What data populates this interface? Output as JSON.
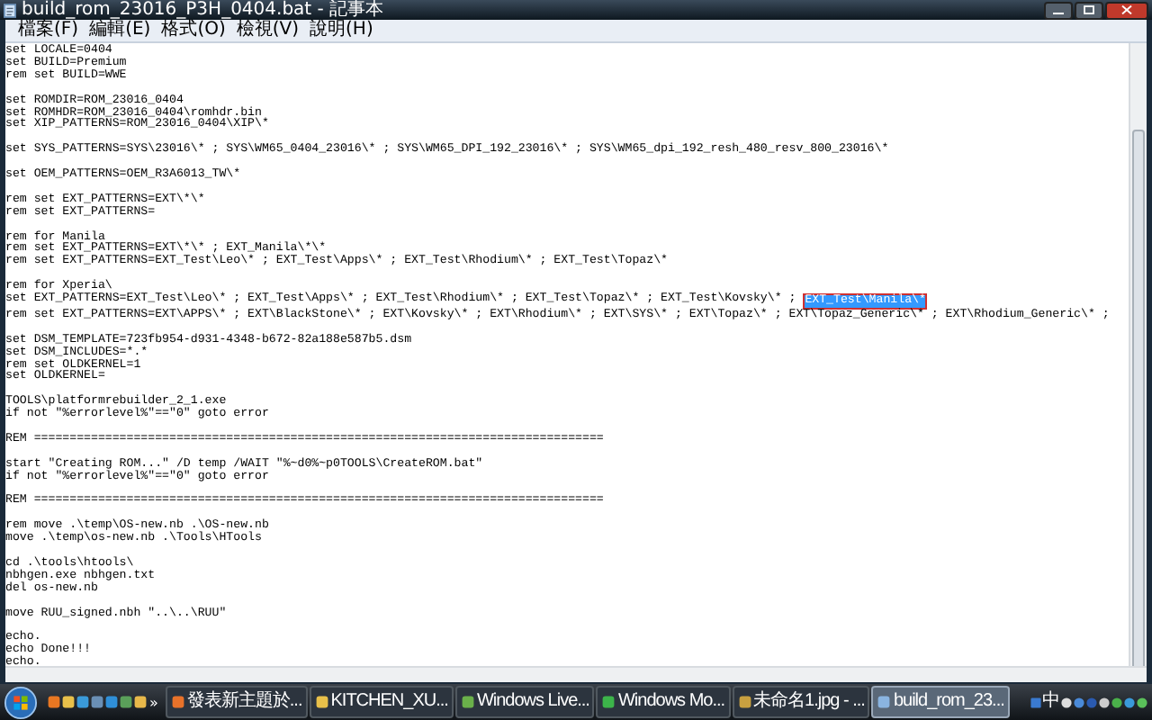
{
  "window": {
    "title": "build_rom_23016_P3H_0404.bat - 記事本"
  },
  "menu": [
    "檔案(F)",
    "編輯(E)",
    "格式(O)",
    "檢視(V)",
    "說明(H)"
  ],
  "editor": {
    "lines": [
      {
        "kind": "code",
        "text": "set LOCALE=0404"
      },
      {
        "kind": "code",
        "text": "set BUILD=Premium"
      },
      {
        "kind": "code",
        "text": "rem set BUILD=WWE"
      },
      {
        "kind": "blank"
      },
      {
        "kind": "code",
        "text": "set ROMDIR=ROM_23016_0404"
      },
      {
        "kind": "code",
        "text": "set ROMHDR=ROM_23016_0404\\romhdr.bin"
      },
      {
        "kind": "code",
        "text": "set XIP_PATTERNS=ROM_23016_0404\\XIP\\*"
      },
      {
        "kind": "blank"
      },
      {
        "kind": "code",
        "text": "set SYS_PATTERNS=SYS\\23016\\* ; SYS\\WM65_0404_23016\\* ; SYS\\WM65_DPI_192_23016\\* ; SYS\\WM65_dpi_192_resh_480_resv_800_23016\\*"
      },
      {
        "kind": "blank"
      },
      {
        "kind": "code",
        "text": "set OEM_PATTERNS=OEM_R3A6013_TW\\*"
      },
      {
        "kind": "blank"
      },
      {
        "kind": "code",
        "text": "rem set EXT_PATTERNS=EXT\\*\\*"
      },
      {
        "kind": "code",
        "text": "rem set EXT_PATTERNS="
      },
      {
        "kind": "blank"
      },
      {
        "kind": "code",
        "text": "rem for Manila"
      },
      {
        "kind": "code",
        "text": "rem set EXT_PATTERNS=EXT\\*\\* ; EXT_Manila\\*\\*"
      },
      {
        "kind": "code",
        "text": "rem set EXT_PATTERNS=EXT_Test\\Leo\\* ; EXT_Test\\Apps\\* ; EXT_Test\\Rhodium\\* ; EXT_Test\\Topaz\\*"
      },
      {
        "kind": "blank"
      },
      {
        "kind": "code",
        "text": "rem for Xperia\\"
      },
      {
        "kind": "code",
        "text": "set EXT_PATTERNS=EXT_Test\\Leo\\* ; EXT_Test\\Apps\\* ; EXT_Test\\Rhodium\\* ; EXT_Test\\Topaz\\* ; EXT_Test\\Kovsky\\* ; ",
        "selection": "EXT_Test\\Manila\\*"
      },
      {
        "kind": "code",
        "text": "rem set EXT_PATTERNS=EXT\\APPS\\* ; EXT\\BlackStone\\* ; EXT\\Kovsky\\* ; EXT\\Rhodium\\* ; EXT\\SYS\\* ; EXT\\Topaz\\* ; EXT\\Topaz_Generic\\* ; EXT\\Rhodium_Generic\\* ;"
      },
      {
        "kind": "blank"
      },
      {
        "kind": "code",
        "text": "set DSM_TEMPLATE=723fb954-d931-4348-b672-82a188e587b5.dsm"
      },
      {
        "kind": "code",
        "text": "set DSM_INCLUDES=*.*"
      },
      {
        "kind": "code",
        "text": "rem set OLDKERNEL=1"
      },
      {
        "kind": "code",
        "text": "set OLDKERNEL="
      },
      {
        "kind": "blank"
      },
      {
        "kind": "code",
        "text": "TOOLS\\platformrebuilder_2_1.exe"
      },
      {
        "kind": "code",
        "text": "if not \"%errorlevel%\"==\"0\" goto error"
      },
      {
        "kind": "blank"
      },
      {
        "kind": "code",
        "text": "REM ================================================================================"
      },
      {
        "kind": "blank"
      },
      {
        "kind": "code",
        "text": "start \"Creating ROM...\" /D temp /WAIT \"%~d0%~p0TOOLS\\CreateROM.bat\""
      },
      {
        "kind": "code",
        "text": "if not \"%errorlevel%\"==\"0\" goto error"
      },
      {
        "kind": "blank"
      },
      {
        "kind": "code",
        "text": "REM ================================================================================"
      },
      {
        "kind": "blank"
      },
      {
        "kind": "code",
        "text": "rem move .\\temp\\OS-new.nb .\\OS-new.nb"
      },
      {
        "kind": "code",
        "text": "move .\\temp\\os-new.nb .\\Tools\\HTools"
      },
      {
        "kind": "blank"
      },
      {
        "kind": "code",
        "text": "cd .\\tools\\htools\\"
      },
      {
        "kind": "code",
        "text": "nbhgen.exe nbhgen.txt"
      },
      {
        "kind": "code",
        "text": "del os-new.nb"
      },
      {
        "kind": "blank"
      },
      {
        "kind": "code",
        "text": "move RUU_signed.nbh \"..\\..\\RUU\""
      },
      {
        "kind": "blank"
      },
      {
        "kind": "code",
        "text": "echo."
      },
      {
        "kind": "code",
        "text": "echo Done!!!"
      },
      {
        "kind": "code",
        "text": "echo."
      }
    ]
  },
  "taskbar": {
    "more": "»",
    "tasks": [
      {
        "label": "發表新主題於...",
        "selected": false
      },
      {
        "label": "KITCHEN_XU...",
        "selected": false
      },
      {
        "label": "Windows Live...",
        "selected": false
      },
      {
        "label": "Windows Mo...",
        "selected": false
      },
      {
        "label": "未命名1.jpg - ...",
        "selected": false
      },
      {
        "label": "build_rom_23...",
        "selected": true
      }
    ],
    "ime": "中"
  }
}
